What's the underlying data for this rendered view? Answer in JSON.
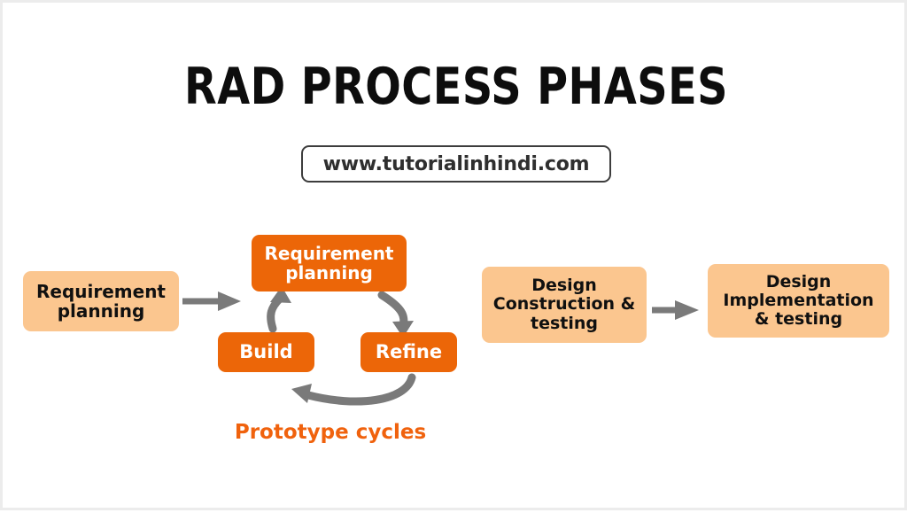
{
  "page": {
    "title": "RAD PROCESS PHASES",
    "website_url": "www.tutorialinhindi.com",
    "background_color": "#ffffff",
    "border_color": "#ececec"
  },
  "palette": {
    "orange_solid": "#ec6608",
    "peach_fill": "#fbc68f",
    "arrow_gray": "#7a7a7a",
    "text_dark": "#101010",
    "text_light": "#ffffff",
    "caption_orange": "#f0620d"
  },
  "diagram": {
    "type": "process-flow",
    "stages": [
      {
        "id": "requirement-planning",
        "label": "Requirement\nplanning",
        "style": "peach"
      },
      {
        "id": "prototype-cycle",
        "caption": "Prototype cycles",
        "style": "orange",
        "nodes": [
          {
            "id": "cycle-requirement-planning",
            "label": "Requirement\nplanning"
          },
          {
            "id": "cycle-refine",
            "label": "Refine"
          },
          {
            "id": "cycle-build",
            "label": "Build"
          }
        ],
        "direction": "clockwise"
      },
      {
        "id": "design-construction-testing",
        "label": "Design\nConstruction &\ntesting",
        "style": "peach"
      },
      {
        "id": "design-implementation-testing",
        "label": "Design\nImplementation\n& testing",
        "style": "peach"
      }
    ],
    "connectors": [
      {
        "id": "arrow-1",
        "from": "requirement-planning",
        "to": "prototype-cycle",
        "shape": "straight",
        "color": "#7a7a7a"
      },
      {
        "id": "arrow-2",
        "from": "prototype-cycle",
        "to": "design-implementation-testing",
        "shape": "straight",
        "color": "#7a7a7a"
      },
      {
        "id": "cycle-arrow-top-right",
        "from": "cycle-requirement-planning",
        "to": "cycle-refine",
        "shape": "curved",
        "color": "#7a7a7a"
      },
      {
        "id": "cycle-arrow-bottom",
        "from": "cycle-refine",
        "to": "cycle-build",
        "shape": "curved",
        "color": "#7a7a7a"
      },
      {
        "id": "cycle-arrow-left",
        "from": "cycle-build",
        "to": "cycle-requirement-planning",
        "shape": "curved",
        "color": "#7a7a7a"
      }
    ]
  }
}
